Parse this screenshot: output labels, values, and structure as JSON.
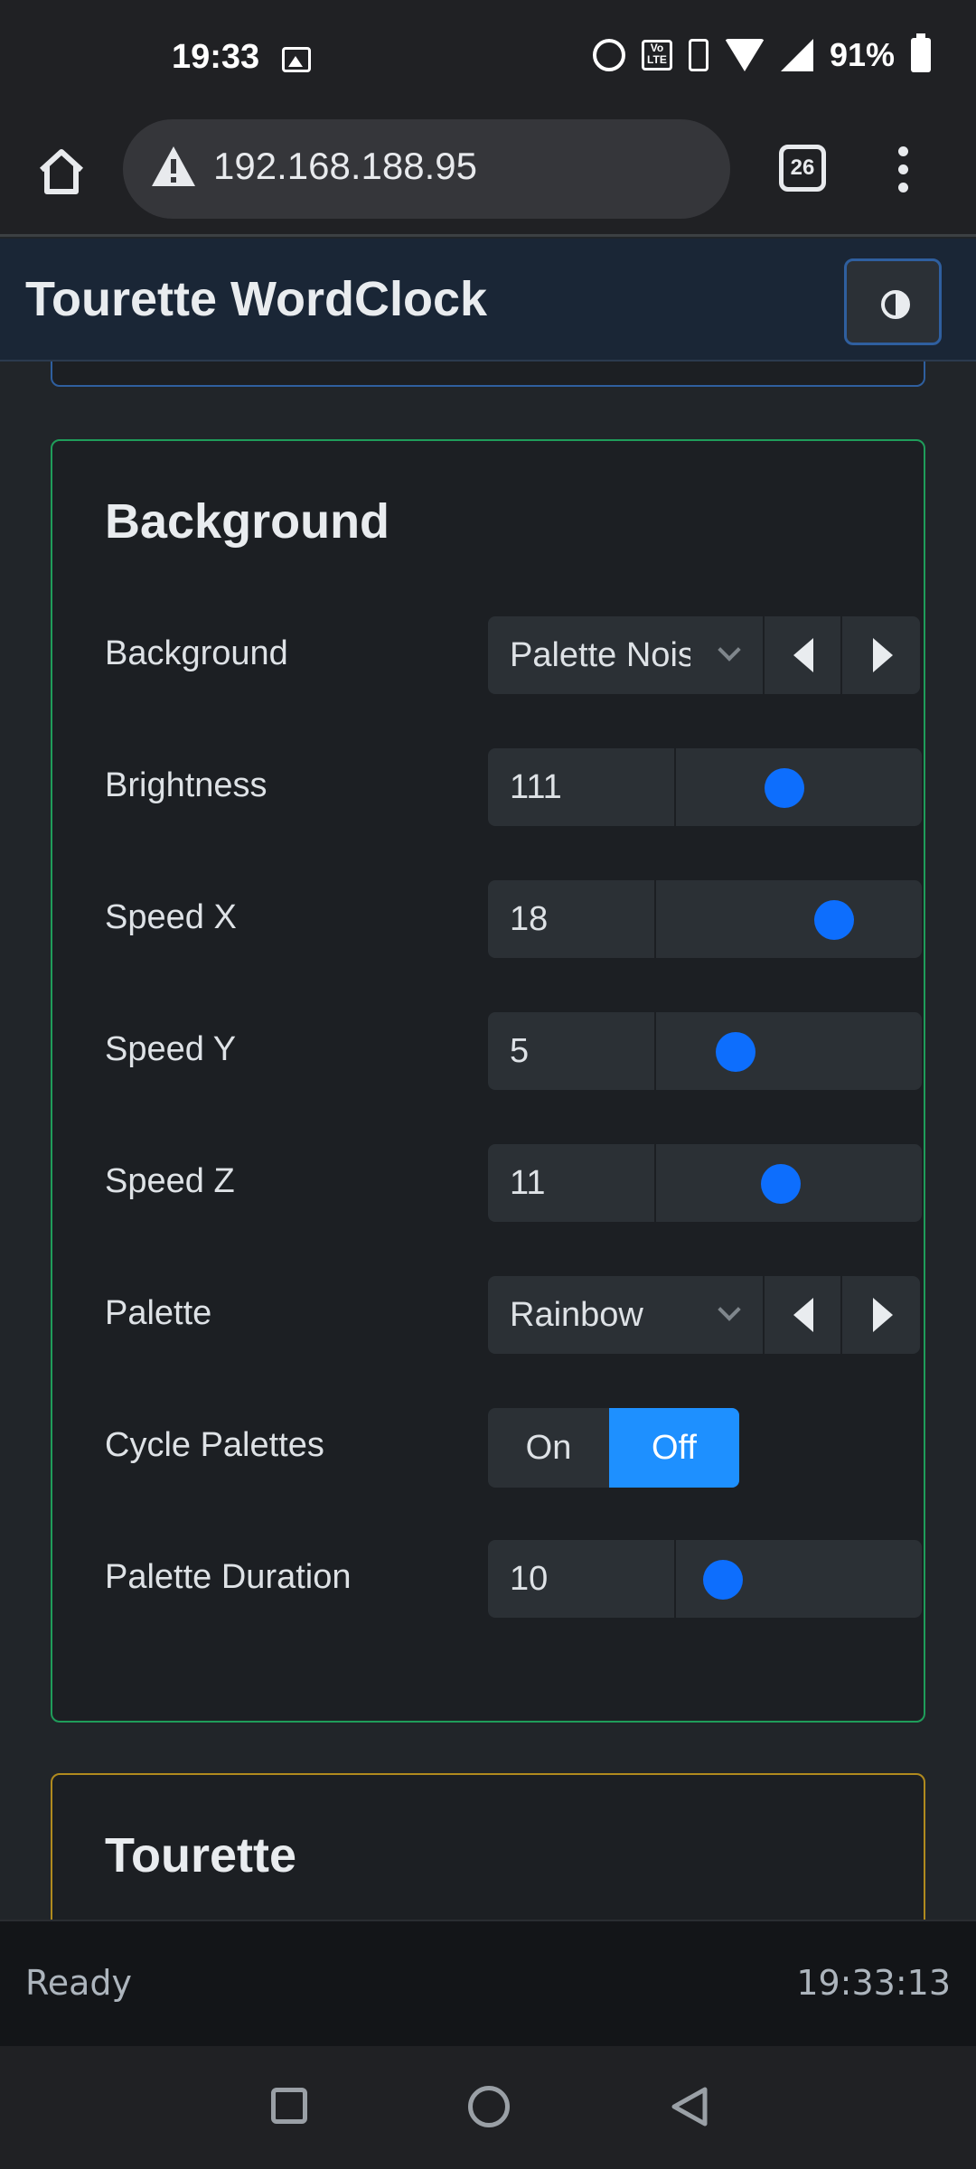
{
  "status_bar": {
    "time": "19:33",
    "volte": "Vo LTE",
    "battery": "91%"
  },
  "browser": {
    "url": "192.168.188.95",
    "tab_count": "26"
  },
  "app": {
    "title": "Tourette WordClock"
  },
  "background_card": {
    "title": "Background",
    "rows": {
      "background": {
        "label": "Background",
        "value": "Palette Noise"
      },
      "brightness": {
        "label": "Brightness",
        "value": "111",
        "slider_fraction": 0.44
      },
      "speed_x": {
        "label": "Speed X",
        "value": "18",
        "slider_fraction": 0.67
      },
      "speed_y": {
        "label": "Speed Y",
        "value": "5",
        "slider_fraction": 0.3
      },
      "speed_z": {
        "label": "Speed Z",
        "value": "11",
        "slider_fraction": 0.47
      },
      "palette": {
        "label": "Palette",
        "value": "Rainbow"
      },
      "cycle_palettes": {
        "label": "Cycle Palettes",
        "on_label": "On",
        "off_label": "Off",
        "selected": "Off"
      },
      "palette_duration": {
        "label": "Palette Duration",
        "value": "10",
        "slider_fraction": 0.19
      }
    }
  },
  "tourette_card": {
    "title": "Tourette"
  },
  "footer": {
    "status": "Ready",
    "time": "19:33:13"
  },
  "colors": {
    "accent": "#0d6efd",
    "toggle_active": "#1e90ff",
    "card_border_bg": "#1f9d5a",
    "card_border_tourette": "#b08a1e"
  }
}
